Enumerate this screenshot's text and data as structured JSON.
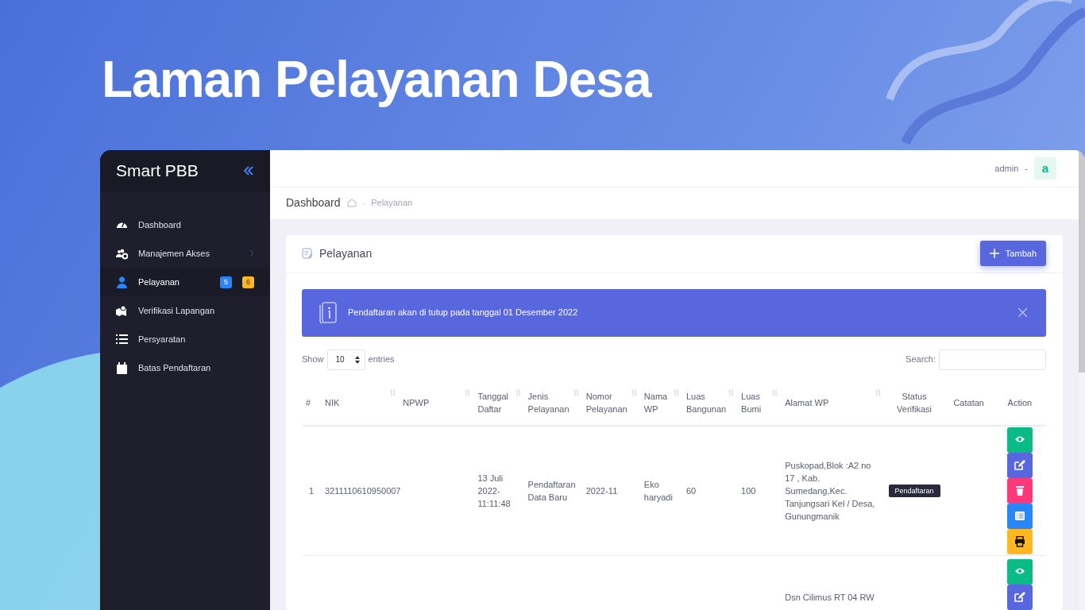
{
  "headline": "Laman Pelayanan Desa",
  "sidebar": {
    "brand": "Smart PBB",
    "items": [
      {
        "label": "Dashboard",
        "kind": "gauge",
        "selected": false,
        "has_submenu": false
      },
      {
        "label": "Manajemen Akses",
        "kind": "users",
        "selected": false,
        "has_submenu": true
      },
      {
        "label": "Pelayanan",
        "kind": "user",
        "selected": true,
        "has_submenu": false,
        "badges": [
          {
            "text": "5",
            "color": "#2786fb"
          },
          {
            "text": "6",
            "color": "#ffb822"
          }
        ]
      },
      {
        "label": "Verifikasi Lapangan",
        "kind": "map",
        "selected": false,
        "has_submenu": false
      },
      {
        "label": "Persyaratan",
        "kind": "list",
        "selected": false,
        "has_submenu": false
      },
      {
        "label": "Batas Pendaftaran",
        "kind": "calendar",
        "selected": false,
        "has_submenu": false
      }
    ]
  },
  "topbar": {
    "user": "admin",
    "separator": "-",
    "avatar": "a"
  },
  "breadcrumb": {
    "title": "Dashboard",
    "separator": "-",
    "current": "Pelayanan"
  },
  "card": {
    "title": "Pelayanan",
    "add_button": "Tambah",
    "alert": "Pendaftaran akan di tutup pada tanggal 01 Desember 2022",
    "length": {
      "before": "Show",
      "value": "10",
      "after": "entries"
    },
    "search_label": "Search:",
    "table": {
      "columns": [
        {
          "label": "#",
          "sortable": false
        },
        {
          "label": "NIK",
          "sortable": true
        },
        {
          "label": "NPWP",
          "sortable": true
        },
        {
          "label": "Tanggal Daftar",
          "sortable": true
        },
        {
          "label": "Jenis Pelayanan",
          "sortable": true
        },
        {
          "label": "Nomor Pelayanan",
          "sortable": true
        },
        {
          "label": "Nama WP",
          "sortable": true
        },
        {
          "label": "Luas Bangunan",
          "sortable": true
        },
        {
          "label": "Luas Bumi",
          "sortable": true
        },
        {
          "label": "Alamat WP",
          "sortable": true
        },
        {
          "label": "Status Verifikasi",
          "sortable": false
        },
        {
          "label": "Catatan",
          "sortable": false
        },
        {
          "label": "Action",
          "sortable": false
        }
      ],
      "rows": [
        {
          "no": "1",
          "nik": "3211110610950007",
          "tanggal": "13 Juli 2022-11:11:48",
          "jenis": "Pendaftaran Data Baru",
          "nomor": "2022-11",
          "nama": "Eko haryadi",
          "luas_bangunan": "60",
          "luas_bumi": "100",
          "alamat": "Puskopad,Blok :A2 no 17 , Kab. Sumedang,Kec. Tanjungsari Kel / Desa, Gunungmanik",
          "status": "Pendaftaran",
          "actions": [
            {
              "kind": "view"
            },
            {
              "kind": "edit"
            },
            {
              "kind": "delete"
            },
            {
              "kind": "list"
            },
            {
              "kind": "print"
            }
          ]
        },
        {
          "alamat": "Dsn Cilimus RT 04 RW",
          "actions": [
            {
              "kind": "view"
            },
            {
              "kind": "edit"
            }
          ]
        }
      ]
    }
  }
}
